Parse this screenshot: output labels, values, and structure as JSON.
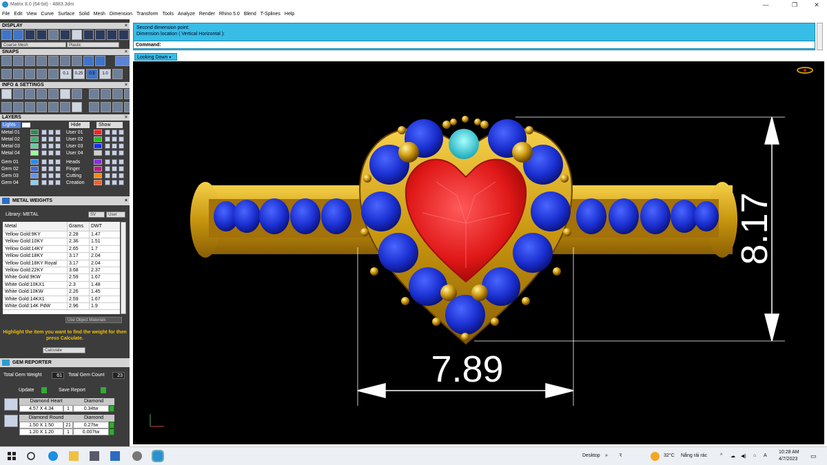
{
  "window": {
    "title": "Matrix 8.0 (64-bit) - 4883.3dm",
    "minimize": "—",
    "maximize": "❐",
    "close": "✕"
  },
  "menu": [
    "File",
    "Edit",
    "View",
    "Curve",
    "Surface",
    "Solid",
    "Mesh",
    "Dimension",
    "Transform",
    "Tools",
    "Analyze",
    "Render",
    "Rhino 5.0",
    "Blend",
    "T-Splines",
    "Help"
  ],
  "display": {
    "header": "DISPLAY",
    "mesh_select": "Coarse Mesh",
    "material_select": "Plastic"
  },
  "snaps": {
    "header": "SNAPS",
    "values": [
      "0.1",
      "0.25",
      "0.5",
      "1.0"
    ]
  },
  "info": {
    "header": "INFO & SETTINGS"
  },
  "layers": {
    "header": "LAYERS",
    "lights": "Lights",
    "hide": "Hide",
    "show": "Show",
    "left": [
      {
        "name": "Metal 01",
        "color": "#2e8b57"
      },
      {
        "name": "Metal 02",
        "color": "#3cb371"
      },
      {
        "name": "Metal 03",
        "color": "#66cdaa"
      },
      {
        "name": "Metal 04",
        "color": "#98fb98"
      },
      {
        "name": "Gem 01",
        "color": "#1e90ff"
      },
      {
        "name": "Gem 02",
        "color": "#4169e1"
      },
      {
        "name": "Gem 03",
        "color": "#6495ed"
      },
      {
        "name": "Gem 04",
        "color": "#87cefa"
      }
    ],
    "right": [
      {
        "name": "User 01",
        "color": "#ff2020"
      },
      {
        "name": "User 02",
        "color": "#20c020"
      },
      {
        "name": "User 03",
        "color": "#1030ff"
      },
      {
        "name": "User 04",
        "color": "#d0d0d0"
      },
      {
        "name": "Heads",
        "color": "#8a2be2"
      },
      {
        "name": "Finger",
        "color": "#c71585"
      },
      {
        "name": "Cutting",
        "color": "#ff8c00"
      },
      {
        "name": "Creation",
        "color": "#ff6020"
      }
    ]
  },
  "metal_weights": {
    "header": "METAL WEIGHTS",
    "library_label": "Library:  METAL",
    "sv": "SV",
    "user": "User",
    "columns": [
      "Metal",
      "Grams",
      "DWT"
    ],
    "rows": [
      [
        "Yellow Gold:9KY",
        "2.28",
        "1.47"
      ],
      [
        "Yellow Gold:10KY",
        "2.36",
        "1.51"
      ],
      [
        "Yellow Gold:14KY",
        "2.65",
        "1.7"
      ],
      [
        "Yellow Gold:18KY",
        "3.17",
        "2.04"
      ],
      [
        "Yellow Gold:18KY Royal",
        "3.17",
        "2.04"
      ],
      [
        "Yellow Gold:22KY",
        "3.68",
        "2.37"
      ],
      [
        "White Gold:9KW",
        "2.59",
        "1.67"
      ],
      [
        "White Gold:10KX1",
        "2.3",
        "1.48"
      ],
      [
        "White Gold:10KW",
        "2.26",
        "1.45"
      ],
      [
        "White Gold:14KX1",
        "2.59",
        "1.67"
      ],
      [
        "White Gold:14K PdW",
        "2.96",
        "1.9"
      ]
    ],
    "use_object_materials": "Use Object Materials",
    "hint": "Highlight the item you want to find the weight for then press Calculate.",
    "calculate": "Calculate"
  },
  "gem_reporter": {
    "header": "GEM REPORTER",
    "total_weight_label": "Total Gem Weight",
    "total_weight": "61",
    "total_count_label": "Total Gem Count",
    "total_count": "23",
    "update": "Update",
    "save_report": "Save Report",
    "groups": [
      {
        "shape": "Diamond Heart",
        "type": "Diamond",
        "rows": [
          [
            "4.57 X 4.34",
            "1",
            "0.34tw"
          ]
        ]
      },
      {
        "shape": "Diamond Round",
        "type": "Diamond",
        "rows": [
          [
            "1.50 X 1.50",
            "21",
            "0.27tw"
          ],
          [
            "1.20 X 1.20",
            "1",
            "0.007tw"
          ]
        ]
      }
    ]
  },
  "command": {
    "line1": "Second dimension point:",
    "line2": "Dimension location ( Vertical  Horizontal ):",
    "prompt": "Command:"
  },
  "viewport": {
    "view_name": "Looking Down",
    "dim_width": "7.89",
    "dim_height": "8.17",
    "colors": {
      "gold": "#d4a017",
      "sapphire": "#1a2fd0",
      "ruby": "#e01818",
      "aqua": "#30d8d8"
    }
  },
  "taskbar": {
    "desktop": "Desktop",
    "temperature": "32°C",
    "weather": "Nắng rải rác",
    "time": "10:28 AM",
    "date": "4/7/2023"
  }
}
